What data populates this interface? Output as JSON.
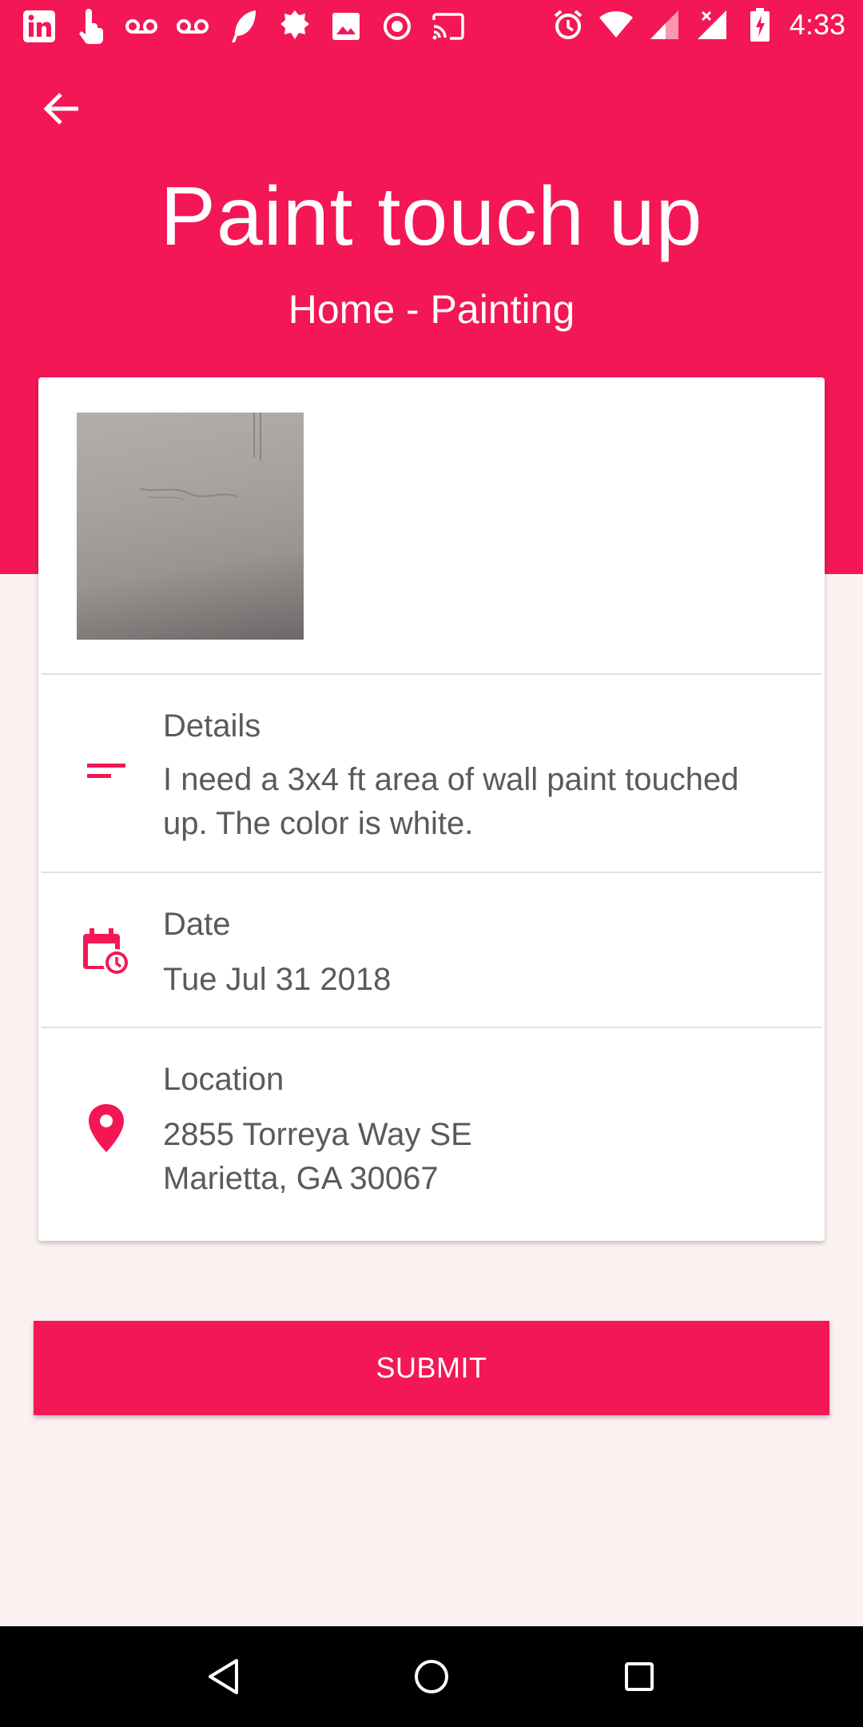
{
  "status_bar": {
    "time": "4:33",
    "left_icons": [
      "linkedin-icon",
      "touch-icon",
      "voicemail-icon",
      "voicemail-icon",
      "feather-icon",
      "badge-icon",
      "image-icon",
      "record-icon",
      "cast-icon"
    ],
    "right_icons": [
      "alarm-icon",
      "wifi-icon",
      "signal-icon",
      "signal-x-icon",
      "battery-charging-icon"
    ]
  },
  "header": {
    "title": "Paint touch up",
    "subtitle": "Home - Painting",
    "color": "#f31755"
  },
  "details": {
    "label": "Details",
    "value_line1": "I need a 3x4 ft area of wall paint touched",
    "value_line2": "up. The color is white."
  },
  "date": {
    "label": "Date",
    "value": "Tue Jul 31 2018"
  },
  "location": {
    "label": "Location",
    "line1": "2855 Torreya Way SE",
    "line2": "Marietta, GA 30067"
  },
  "submit": {
    "label": "SUBMIT"
  },
  "nav": {
    "icons": [
      "back-triangle-icon",
      "home-circle-icon",
      "recents-square-icon"
    ]
  }
}
